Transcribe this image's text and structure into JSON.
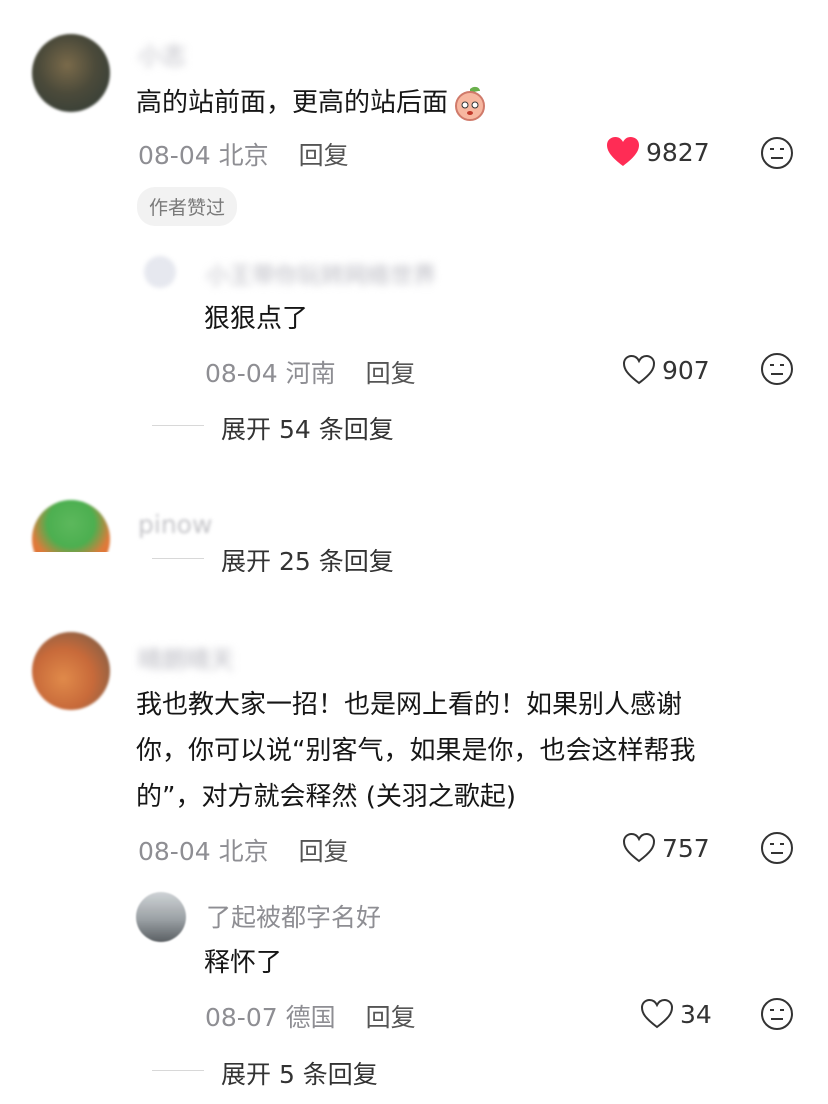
{
  "comments": [
    {
      "name": "小志",
      "text": "高的站前面，更高的站后面",
      "date": "08-04",
      "location": "北京",
      "reply_label": "回复",
      "likes": "9827",
      "liked": true,
      "badge": "作者赞过",
      "sub_reply": {
        "name": "小王带你玩转网络世界",
        "text": "狠狠点了",
        "date": "08-04",
        "location": "河南",
        "reply_label": "回复",
        "likes": "907"
      },
      "expand": "展开 54 条回复"
    },
    {
      "name": "pinow",
      "expand": "展开 25 条回复"
    },
    {
      "name": "晴朗晴天",
      "text_lines": [
        "我也教大家一招！也是网上看的！如果别人感谢",
        "你，你可以说“别客气，如果是你，也会这样帮我",
        "的”，对方就会释然 (关羽之歌起)"
      ],
      "date": "08-04",
      "location": "北京",
      "reply_label": "回复",
      "likes": "757",
      "sub_reply": {
        "name": "了起被都字名好",
        "text": "释怀了",
        "date": "08-07",
        "location": "德国",
        "reply_label": "回复",
        "likes": "34"
      },
      "expand": "展开 5 条回复"
    }
  ],
  "colors": {
    "like_red": "#ff2c55",
    "meta_gray": "#8e8e93"
  },
  "icons": [
    "heart-icon",
    "heart-outline-icon",
    "dislike-face-icon",
    "peach-emoji-icon"
  ]
}
